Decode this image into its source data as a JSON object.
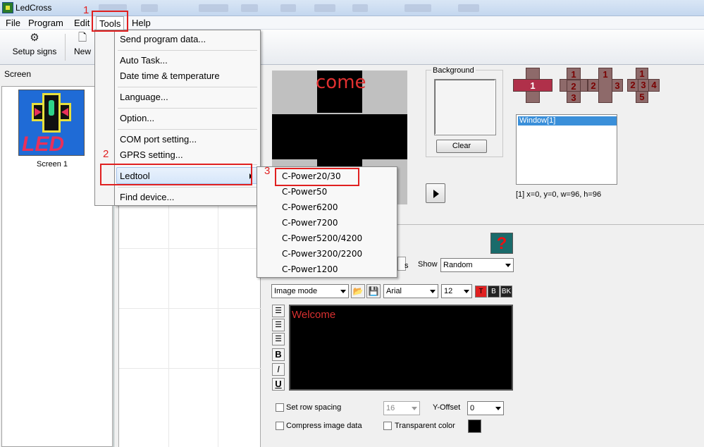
{
  "window": {
    "title": "LedCross"
  },
  "menubar": {
    "file": "File",
    "program": "Program",
    "edit": "Edit",
    "tools": "Tools",
    "help": "Help"
  },
  "toolbar": {
    "setup_signs": "Setup signs",
    "new": "New"
  },
  "left_panel": {
    "label": "Screen",
    "screen_name": "Screen 1",
    "thumb_text": "LED"
  },
  "tools_menu": {
    "send_program_data": "Send program data...",
    "auto_task": "Auto Task...",
    "date_time_temperature": "Date time & temperature",
    "language": "Language...",
    "option": "Option...",
    "com_port_setting": "COM port setting...",
    "gprs_setting": "GPRS setting...",
    "ledtool": "Ledtool",
    "find_device": "Find device..."
  },
  "ledtool_submenu": [
    "C-Power20/30",
    "C-Power50",
    "C-Power6200",
    "C-Power7200",
    "C-Power5200/4200",
    "C-Power3200/2200",
    "C-Power1200"
  ],
  "annotations": {
    "step1": "1",
    "step2": "2",
    "step3": "3"
  },
  "preview": {
    "text": "come"
  },
  "background": {
    "label": "Background",
    "clear_button": "Clear"
  },
  "cross_layouts": {
    "layout1": [
      "1"
    ],
    "layout2": [
      "1",
      "2",
      "3"
    ],
    "layout3": [
      "1",
      "2",
      "3"
    ],
    "layout4": [
      "1",
      "2",
      "3",
      "4",
      "5"
    ]
  },
  "windows": {
    "items": [
      "Window[1]"
    ],
    "info": "[1] x=0, y=0, w=96, h=96"
  },
  "effects": {
    "show_label": "Show",
    "show_value": "Random",
    "s_label": "s",
    "help_glyph": "?"
  },
  "format": {
    "mode": "Image mode",
    "font": "Arial",
    "size": "12",
    "text_color_btn": "T",
    "bold_color_btn": "B",
    "bk_color_btn": "BK",
    "bold": "B",
    "italic": "I",
    "underline": "U"
  },
  "editor": {
    "text": "Welcome"
  },
  "options": {
    "set_row_spacing": "Set row spacing",
    "row_spacing_value": "16",
    "y_offset_label": "Y-Offset",
    "y_offset_value": "0",
    "compress_image_data": "Compress image data",
    "transparent_color": "Transparent color"
  },
  "colors": {
    "accent_red": "#e02020",
    "preview_text": "#e03030",
    "selection": "#3a8fd9"
  }
}
